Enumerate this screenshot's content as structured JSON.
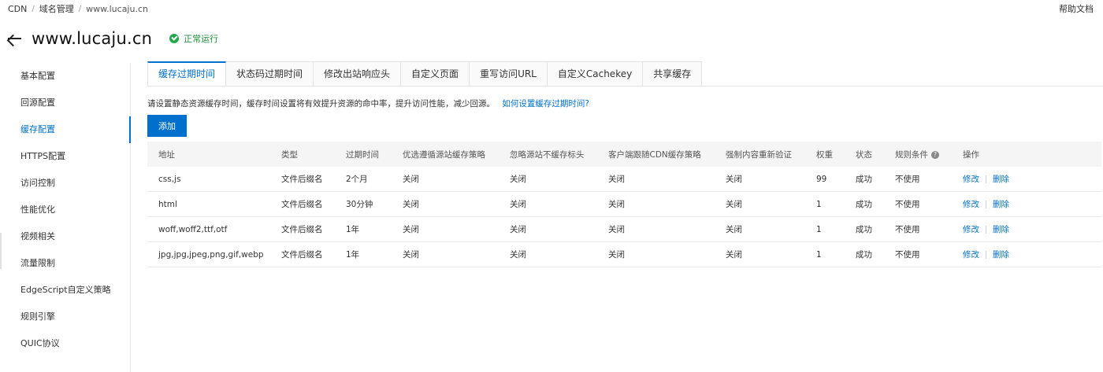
{
  "breadcrumb": [
    "CDN",
    "域名管理",
    "www.lucaju.cn"
  ],
  "help_doc": "帮助文档",
  "title": "www.lucaju.cn",
  "status": "正常运行",
  "sidebar": {
    "items": [
      {
        "label": "基本配置"
      },
      {
        "label": "回源配置"
      },
      {
        "label": "缓存配置"
      },
      {
        "label": "HTTPS配置"
      },
      {
        "label": "访问控制"
      },
      {
        "label": "性能优化"
      },
      {
        "label": "视频相关"
      },
      {
        "label": "流量限制"
      },
      {
        "label": "EdgeScript自定义策略"
      },
      {
        "label": "规则引擎"
      },
      {
        "label": "QUIC协议"
      }
    ],
    "active_index": 2
  },
  "tabs": [
    {
      "label": "缓存过期时间"
    },
    {
      "label": "状态码过期时间"
    },
    {
      "label": "修改出站响应头"
    },
    {
      "label": "自定义页面"
    },
    {
      "label": "重写访问URL"
    },
    {
      "label": "自定义Cachekey"
    },
    {
      "label": "共享缓存"
    }
  ],
  "active_tab": 0,
  "description": "请设置静态资源缓存时间，缓存时间设置将有效提升资源的命中率，提升访问性能，减少回源。",
  "description_link": "如何设置缓存过期时间?",
  "add_button": "添加",
  "table": {
    "headers": [
      "地址",
      "类型",
      "过期时间",
      "优选遵循源站缓存策略",
      "忽略源站不缓存标头",
      "客户端跟随CDN缓存策略",
      "强制内容重新验证",
      "权重",
      "状态",
      "规则条件",
      "操作"
    ],
    "rows": [
      [
        "css,js",
        "文件后缀名",
        "2个月",
        "关闭",
        "关闭",
        "关闭",
        "关闭",
        "99",
        "成功",
        "不使用"
      ],
      [
        "html",
        "文件后缀名",
        "30分钟",
        "关闭",
        "关闭",
        "关闭",
        "关闭",
        "1",
        "成功",
        "不使用"
      ],
      [
        "woff,woff2,ttf,otf",
        "文件后缀名",
        "1年",
        "关闭",
        "关闭",
        "关闭",
        "关闭",
        "1",
        "成功",
        "不使用"
      ],
      [
        "jpg,jpg,jpeg,png,gif,webp",
        "文件后缀名",
        "1年",
        "关闭",
        "关闭",
        "关闭",
        "关闭",
        "1",
        "成功",
        "不使用"
      ]
    ],
    "edit_label": "修改",
    "delete_label": "删除"
  },
  "colors": {
    "accent": "#0070cc",
    "status_green": "#22a84a"
  }
}
